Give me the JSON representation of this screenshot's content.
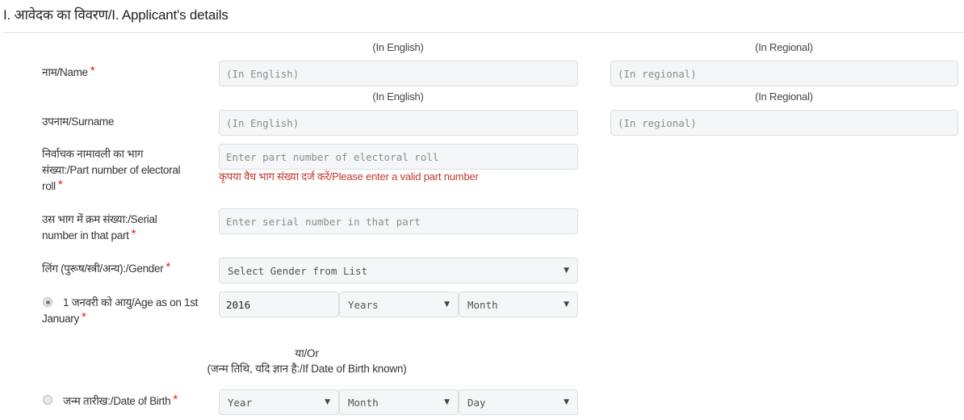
{
  "section": {
    "title": "I. आवेदक का विवरण/I. Applicant's details"
  },
  "hints": {
    "english": "(In English)",
    "regional": "(In Regional)"
  },
  "fields": {
    "name": {
      "label": "नाम/Name",
      "required": "*",
      "english_placeholder": "(In English)",
      "regional_placeholder": "(In regional)"
    },
    "surname": {
      "label": "उपनाम/Surname",
      "english_placeholder": "(In English)",
      "regional_placeholder": "(In regional)"
    },
    "part_number": {
      "label_line1": "निर्वाचक नामावली का भाग",
      "label_line2": "संख्या:/Part number of electoral",
      "label_line3": "roll",
      "required": "*",
      "placeholder": "Enter part number of electoral roll",
      "error": "कृपया वैध भाग संख्या दर्ज करें/Please enter a valid part number"
    },
    "serial_number": {
      "label_line1": "उस भाग में क्रम संख्या:/Serial",
      "label_line2": "number in that part",
      "required": "*",
      "placeholder": "Enter serial number in that part"
    },
    "gender": {
      "label": "लिंग (पुरूष/स्त्री/अन्य):/Gender",
      "required": "*",
      "selected": "Select Gender from List"
    },
    "age": {
      "label_line1": "1 जनवरी को आयु/Age as on 1st",
      "label_line2": "January",
      "required": "*",
      "checked": true,
      "year_value": "2016",
      "years_select": "Years",
      "month_select": "Month"
    },
    "or_block": {
      "line1": "या/Or",
      "line2": "(जन्म तिथि, यदि ज्ञान है:/If Date of Birth known)"
    },
    "dob": {
      "label": "जन्म तारीख:/Date of Birth",
      "required": "*",
      "checked": false,
      "year_select": "Year",
      "month_select": "Month",
      "day_select": "Day"
    }
  },
  "icons": {
    "caret": "▼"
  },
  "colors": {
    "required": "#e0201c",
    "error": "#c0392b",
    "input_bg": "#f5f6f7",
    "input_border": "#dadde0"
  }
}
